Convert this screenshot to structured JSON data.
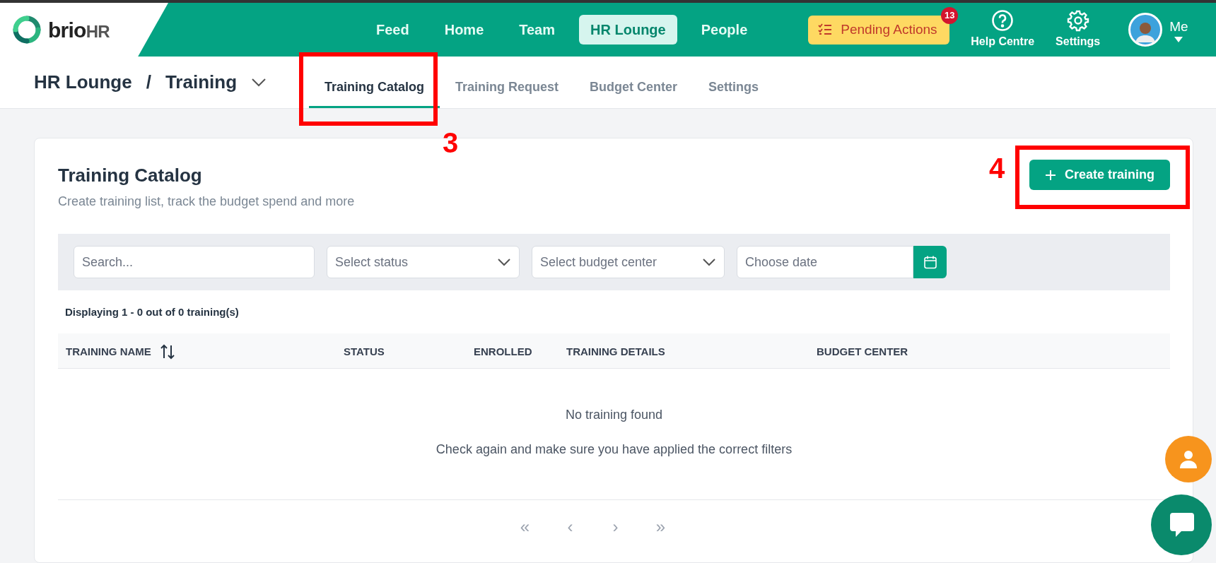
{
  "brand": {
    "name_bold": "brio",
    "name_light": "HR"
  },
  "nav": [
    {
      "label": "Feed",
      "selected": false
    },
    {
      "label": "Home",
      "selected": false
    },
    {
      "label": "Team",
      "selected": false
    },
    {
      "label": "HR Lounge",
      "selected": true
    },
    {
      "label": "People",
      "selected": false
    }
  ],
  "pending_actions": {
    "label": "Pending Actions",
    "count": "13"
  },
  "top_actions": [
    {
      "kind": "help",
      "label": "Help Centre"
    },
    {
      "kind": "settings",
      "label": "Settings"
    }
  ],
  "user": {
    "label": "Me"
  },
  "breadcrumb": [
    "HR Lounge",
    "/",
    "Training"
  ],
  "tabs": [
    {
      "label": "Training Catalog",
      "selected": true
    },
    {
      "label": "Training Request",
      "selected": false
    },
    {
      "label": "Budget Center",
      "selected": false
    },
    {
      "label": "Settings",
      "selected": false
    }
  ],
  "page": {
    "title": "Training Catalog",
    "subtitle": "Create training list, track the budget spend and more",
    "create_button": "Create training"
  },
  "filters": [
    {
      "kind": "text",
      "placeholder": "Search..."
    },
    {
      "kind": "select",
      "placeholder": "Select status"
    },
    {
      "kind": "select",
      "placeholder": "Select budget center"
    },
    {
      "kind": "date",
      "placeholder": "Choose date"
    }
  ],
  "count_text": "Displaying 1 - 0 out of 0 training(s)",
  "table": {
    "columns": [
      {
        "label": "TRAINING NAME",
        "sortable": true
      },
      {
        "label": "STATUS",
        "sortable": false
      },
      {
        "label": "ENROLLED",
        "sortable": false
      },
      {
        "label": "TRAINING DETAILS",
        "sortable": false
      },
      {
        "label": "BUDGET CENTER",
        "sortable": false
      }
    ],
    "empty_title": "No training found",
    "empty_text": "Check again and make sure you have applied the correct filters"
  },
  "pagination": [
    "«",
    "‹",
    "›",
    "»"
  ],
  "annotations": [
    {
      "number": "3"
    },
    {
      "number": "4"
    }
  ]
}
